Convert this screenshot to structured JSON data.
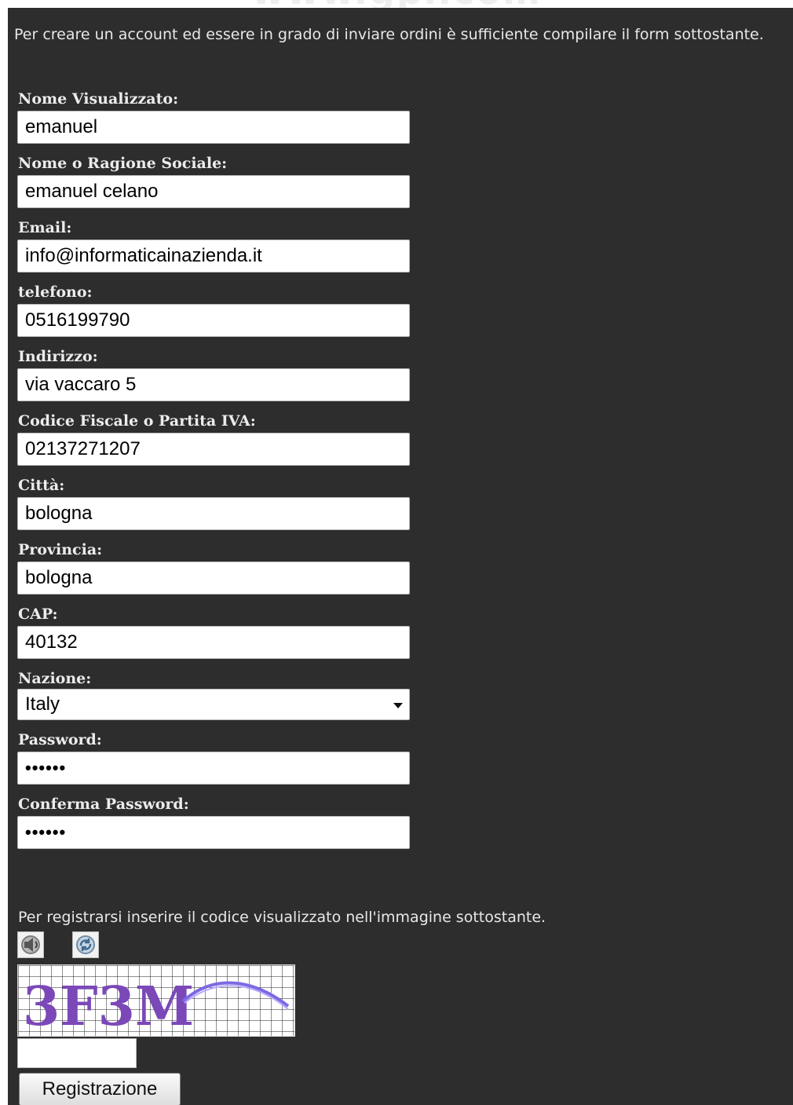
{
  "header": {
    "watermark": "www.gpi.com"
  },
  "form": {
    "intro": "Per creare un account ed essere in grado di inviare ordini è sufficiente compilare il form sottostante.",
    "fields": [
      {
        "label": "Nome Visualizzato:",
        "value": "emanuel"
      },
      {
        "label": "Nome o Ragione Sociale:",
        "value": "emanuel celano"
      },
      {
        "label": "Email:",
        "value": "info@informaticainazienda.it"
      },
      {
        "label": "telefono:",
        "value": "0516199790"
      },
      {
        "label": "Indirizzo:",
        "value": "via vaccaro 5"
      },
      {
        "label": "Codice Fiscale o Partita IVA:",
        "value": "02137271207"
      },
      {
        "label": "Città:",
        "value": "bologna"
      },
      {
        "label": "Provincia:",
        "value": "bologna"
      },
      {
        "label": "CAP:",
        "value": "40132"
      }
    ],
    "country": {
      "label": "Nazione:",
      "value": "Italy"
    },
    "password": {
      "label": "Password:",
      "value": "••••••"
    },
    "confirm_password": {
      "label": "Conferma Password:",
      "value": "••••••"
    }
  },
  "captcha": {
    "instruction": "Per registrarsi inserire il codice visualizzato nell'immagine sottostante.",
    "code": "3F3M",
    "input_value": "",
    "icons": [
      "audio-icon",
      "refresh-icon"
    ]
  },
  "actions": {
    "register_label": "Registrazione"
  }
}
